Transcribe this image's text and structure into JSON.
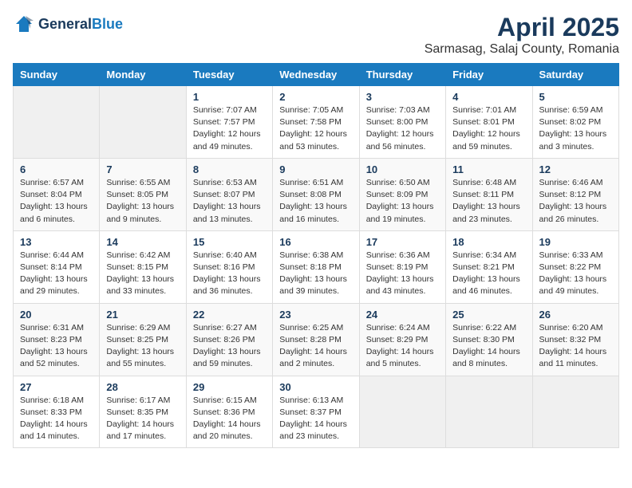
{
  "logo": {
    "general": "General",
    "blue": "Blue"
  },
  "title": "April 2025",
  "location": "Sarmasag, Salaj County, Romania",
  "weekdays": [
    "Sunday",
    "Monday",
    "Tuesday",
    "Wednesday",
    "Thursday",
    "Friday",
    "Saturday"
  ],
  "weeks": [
    [
      {
        "day": "",
        "info": ""
      },
      {
        "day": "",
        "info": ""
      },
      {
        "day": "1",
        "info": "Sunrise: 7:07 AM\nSunset: 7:57 PM\nDaylight: 12 hours and 49 minutes."
      },
      {
        "day": "2",
        "info": "Sunrise: 7:05 AM\nSunset: 7:58 PM\nDaylight: 12 hours and 53 minutes."
      },
      {
        "day": "3",
        "info": "Sunrise: 7:03 AM\nSunset: 8:00 PM\nDaylight: 12 hours and 56 minutes."
      },
      {
        "day": "4",
        "info": "Sunrise: 7:01 AM\nSunset: 8:01 PM\nDaylight: 12 hours and 59 minutes."
      },
      {
        "day": "5",
        "info": "Sunrise: 6:59 AM\nSunset: 8:02 PM\nDaylight: 13 hours and 3 minutes."
      }
    ],
    [
      {
        "day": "6",
        "info": "Sunrise: 6:57 AM\nSunset: 8:04 PM\nDaylight: 13 hours and 6 minutes."
      },
      {
        "day": "7",
        "info": "Sunrise: 6:55 AM\nSunset: 8:05 PM\nDaylight: 13 hours and 9 minutes."
      },
      {
        "day": "8",
        "info": "Sunrise: 6:53 AM\nSunset: 8:07 PM\nDaylight: 13 hours and 13 minutes."
      },
      {
        "day": "9",
        "info": "Sunrise: 6:51 AM\nSunset: 8:08 PM\nDaylight: 13 hours and 16 minutes."
      },
      {
        "day": "10",
        "info": "Sunrise: 6:50 AM\nSunset: 8:09 PM\nDaylight: 13 hours and 19 minutes."
      },
      {
        "day": "11",
        "info": "Sunrise: 6:48 AM\nSunset: 8:11 PM\nDaylight: 13 hours and 23 minutes."
      },
      {
        "day": "12",
        "info": "Sunrise: 6:46 AM\nSunset: 8:12 PM\nDaylight: 13 hours and 26 minutes."
      }
    ],
    [
      {
        "day": "13",
        "info": "Sunrise: 6:44 AM\nSunset: 8:14 PM\nDaylight: 13 hours and 29 minutes."
      },
      {
        "day": "14",
        "info": "Sunrise: 6:42 AM\nSunset: 8:15 PM\nDaylight: 13 hours and 33 minutes."
      },
      {
        "day": "15",
        "info": "Sunrise: 6:40 AM\nSunset: 8:16 PM\nDaylight: 13 hours and 36 minutes."
      },
      {
        "day": "16",
        "info": "Sunrise: 6:38 AM\nSunset: 8:18 PM\nDaylight: 13 hours and 39 minutes."
      },
      {
        "day": "17",
        "info": "Sunrise: 6:36 AM\nSunset: 8:19 PM\nDaylight: 13 hours and 43 minutes."
      },
      {
        "day": "18",
        "info": "Sunrise: 6:34 AM\nSunset: 8:21 PM\nDaylight: 13 hours and 46 minutes."
      },
      {
        "day": "19",
        "info": "Sunrise: 6:33 AM\nSunset: 8:22 PM\nDaylight: 13 hours and 49 minutes."
      }
    ],
    [
      {
        "day": "20",
        "info": "Sunrise: 6:31 AM\nSunset: 8:23 PM\nDaylight: 13 hours and 52 minutes."
      },
      {
        "day": "21",
        "info": "Sunrise: 6:29 AM\nSunset: 8:25 PM\nDaylight: 13 hours and 55 minutes."
      },
      {
        "day": "22",
        "info": "Sunrise: 6:27 AM\nSunset: 8:26 PM\nDaylight: 13 hours and 59 minutes."
      },
      {
        "day": "23",
        "info": "Sunrise: 6:25 AM\nSunset: 8:28 PM\nDaylight: 14 hours and 2 minutes."
      },
      {
        "day": "24",
        "info": "Sunrise: 6:24 AM\nSunset: 8:29 PM\nDaylight: 14 hours and 5 minutes."
      },
      {
        "day": "25",
        "info": "Sunrise: 6:22 AM\nSunset: 8:30 PM\nDaylight: 14 hours and 8 minutes."
      },
      {
        "day": "26",
        "info": "Sunrise: 6:20 AM\nSunset: 8:32 PM\nDaylight: 14 hours and 11 minutes."
      }
    ],
    [
      {
        "day": "27",
        "info": "Sunrise: 6:18 AM\nSunset: 8:33 PM\nDaylight: 14 hours and 14 minutes."
      },
      {
        "day": "28",
        "info": "Sunrise: 6:17 AM\nSunset: 8:35 PM\nDaylight: 14 hours and 17 minutes."
      },
      {
        "day": "29",
        "info": "Sunrise: 6:15 AM\nSunset: 8:36 PM\nDaylight: 14 hours and 20 minutes."
      },
      {
        "day": "30",
        "info": "Sunrise: 6:13 AM\nSunset: 8:37 PM\nDaylight: 14 hours and 23 minutes."
      },
      {
        "day": "",
        "info": ""
      },
      {
        "day": "",
        "info": ""
      },
      {
        "day": "",
        "info": ""
      }
    ]
  ]
}
